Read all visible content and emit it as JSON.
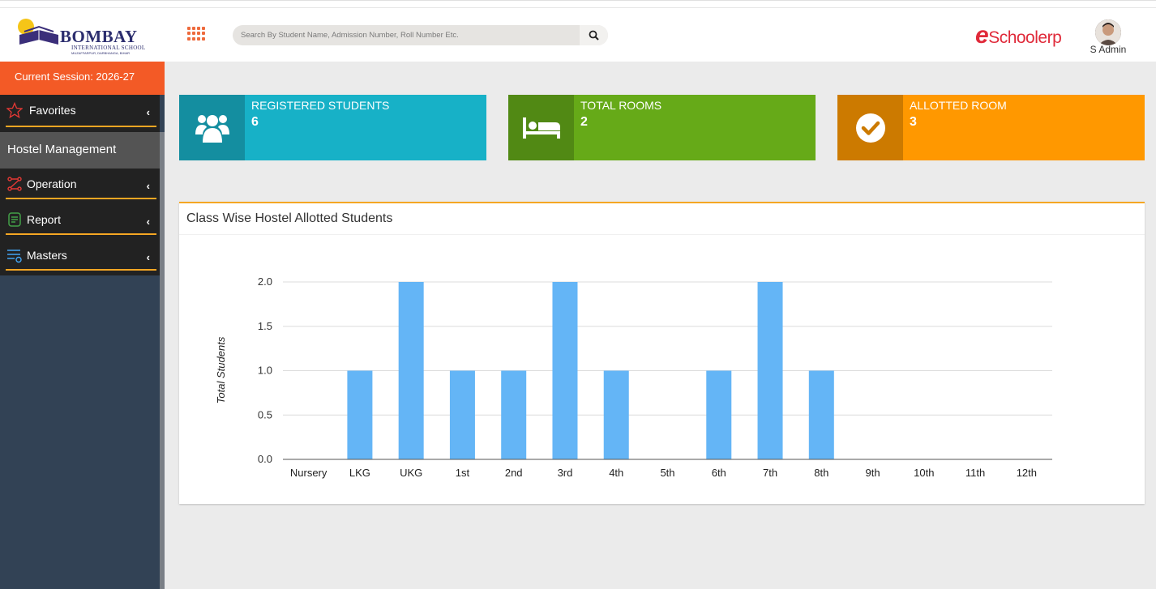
{
  "header": {
    "logo": {
      "name": "BOMBAY",
      "subtitle": "INTERNATIONAL SCHOOL",
      "location": "MUZAFFARPUR, DARBHANGA, BIHAR"
    },
    "search": {
      "placeholder": "Search By Student Name, Admission Number, Roll Number Etc.",
      "value": ""
    },
    "brand": {
      "prefix": "e",
      "main": "School",
      "suffix": "erp"
    },
    "user": {
      "name": "S Admin"
    }
  },
  "sidebar": {
    "session": "Current Session: 2026-27",
    "favorites": "Favorites",
    "module_title": "Hostel Management",
    "items": [
      {
        "label": "Operation",
        "icon": "operation-icon"
      },
      {
        "label": "Report",
        "icon": "report-icon"
      },
      {
        "label": "Masters",
        "icon": "masters-icon"
      }
    ]
  },
  "cards": [
    {
      "label": "REGISTERED STUDENTS",
      "value": "6",
      "icon": "users-icon",
      "color": "#17b1c7",
      "icon_bg": "#148ea0"
    },
    {
      "label": "TOTAL ROOMS",
      "value": "2",
      "icon": "bed-icon",
      "color": "#66aa18",
      "icon_bg": "#518914"
    },
    {
      "label": "ALLOTTED ROOM",
      "value": "3",
      "icon": "check-circle-icon",
      "color": "#ff9800",
      "icon_bg": "#cc7a00"
    }
  ],
  "panel": {
    "title": "Class Wise Hostel Allotted Students"
  },
  "chart_data": {
    "type": "bar",
    "title": "",
    "xlabel": "",
    "ylabel": "Total Students",
    "categories": [
      "Nursery",
      "LKG",
      "UKG",
      "1st",
      "2nd",
      "3rd",
      "4th",
      "5th",
      "6th",
      "7th",
      "8th",
      "9th",
      "10th",
      "11th",
      "12th"
    ],
    "values": [
      0,
      1,
      2,
      1,
      1,
      2,
      1,
      0,
      1,
      2,
      1,
      0,
      0,
      0,
      0
    ],
    "ylim": [
      0,
      2
    ],
    "yticks": [
      "0.0",
      "0.5",
      "1.0",
      "1.5",
      "2.0"
    ],
    "grid": true,
    "bar_color": "#64b5f6"
  }
}
